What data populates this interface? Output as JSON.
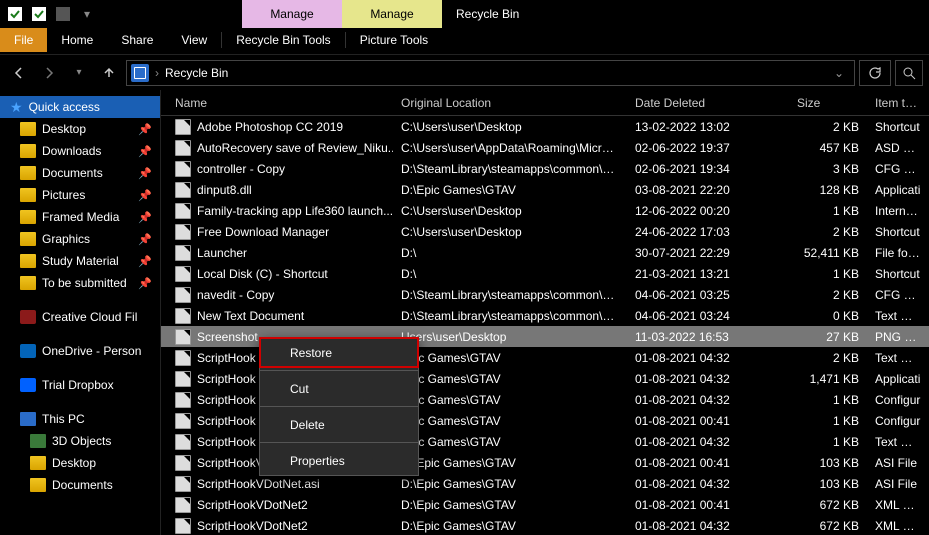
{
  "title": "Recycle Bin",
  "manage_tabs": [
    "Manage",
    "Manage"
  ],
  "ribbon": {
    "file": "File",
    "home": "Home",
    "share": "Share",
    "view": "View",
    "rbt": "Recycle Bin Tools",
    "pt": "Picture Tools"
  },
  "address": "Recycle Bin",
  "sidebar": {
    "quick": "Quick access",
    "pinned": [
      {
        "label": "Desktop"
      },
      {
        "label": "Downloads"
      },
      {
        "label": "Documents"
      },
      {
        "label": "Pictures"
      },
      {
        "label": "Framed Media"
      },
      {
        "label": "Graphics"
      },
      {
        "label": "Study Material"
      },
      {
        "label": "To be submitted"
      }
    ],
    "cc": "Creative Cloud Fil",
    "od": "OneDrive - Person",
    "db": "Trial Dropbox",
    "pc": "This PC",
    "pc_items": [
      {
        "label": "3D Objects"
      },
      {
        "label": "Desktop"
      },
      {
        "label": "Documents"
      }
    ]
  },
  "columns": {
    "name": "Name",
    "loc": "Original Location",
    "date": "Date Deleted",
    "size": "Size",
    "type": "Item type"
  },
  "rows": [
    {
      "name": "Adobe Photoshop CC 2019",
      "loc": "C:\\Users\\user\\Desktop",
      "date": "13-02-2022 13:02",
      "size": "2 KB",
      "type": "Shortcut"
    },
    {
      "name": "AutoRecovery save of Review_Niku...",
      "loc": "C:\\Users\\user\\AppData\\Roaming\\Micros...",
      "date": "02-06-2022 19:37",
      "size": "457 KB",
      "type": "ASD File"
    },
    {
      "name": "controller - Copy",
      "loc": "D:\\SteamLibrary\\steamapps\\common\\C...",
      "date": "02-06-2021 19:34",
      "size": "3 KB",
      "type": "CFG File"
    },
    {
      "name": "dinput8.dll",
      "loc": "D:\\Epic Games\\GTAV",
      "date": "03-08-2021 22:20",
      "size": "128 KB",
      "type": "Applicati"
    },
    {
      "name": "Family-tracking app Life360 launch...",
      "loc": "C:\\Users\\user\\Desktop",
      "date": "12-06-2022 00:20",
      "size": "1 KB",
      "type": "Internet S"
    },
    {
      "name": "Free Download Manager",
      "loc": "C:\\Users\\user\\Desktop",
      "date": "24-06-2022 17:03",
      "size": "2 KB",
      "type": "Shortcut"
    },
    {
      "name": "Launcher",
      "loc": "D:\\",
      "date": "30-07-2021 22:29",
      "size": "52,411 KB",
      "type": "File folde"
    },
    {
      "name": "Local Disk (C) - Shortcut",
      "loc": "D:\\",
      "date": "21-03-2021 13:21",
      "size": "1 KB",
      "type": "Shortcut"
    },
    {
      "name": "navedit - Copy",
      "loc": "D:\\SteamLibrary\\steamapps\\common\\C...",
      "date": "04-06-2021 03:25",
      "size": "2 KB",
      "type": "CFG File"
    },
    {
      "name": "New Text Document",
      "loc": "D:\\SteamLibrary\\steamapps\\common\\C...",
      "date": "04-06-2021 03:24",
      "size": "0 KB",
      "type": "Text Doc"
    },
    {
      "name": "Screenshot",
      "loc": "Users\\user\\Desktop",
      "date": "11-03-2022 16:53",
      "size": "27 KB",
      "type": "PNG File",
      "sel": true
    },
    {
      "name": "ScriptHook",
      "loc": "Epic Games\\GTAV",
      "date": "01-08-2021 04:32",
      "size": "2 KB",
      "type": "Text Doc"
    },
    {
      "name": "ScriptHook",
      "loc": "Epic Games\\GTAV",
      "date": "01-08-2021 04:32",
      "size": "1,471 KB",
      "type": "Applicati"
    },
    {
      "name": "ScriptHook",
      "loc": "Epic Games\\GTAV",
      "date": "01-08-2021 04:32",
      "size": "1 KB",
      "type": "Configur"
    },
    {
      "name": "ScriptHook",
      "loc": "Epic Games\\GTAV",
      "date": "01-08-2021 00:41",
      "size": "1 KB",
      "type": "Configur"
    },
    {
      "name": "ScriptHook",
      "loc": "Epic Games\\GTAV",
      "date": "01-08-2021 04:32",
      "size": "1 KB",
      "type": "Text Doc"
    },
    {
      "name": "ScriptHookVDotNet.asi",
      "loc": "D:\\Epic Games\\GTAV",
      "date": "01-08-2021 00:41",
      "size": "103 KB",
      "type": "ASI File"
    },
    {
      "name": "ScriptHookVDotNet.asi",
      "loc": "D:\\Epic Games\\GTAV",
      "date": "01-08-2021 04:32",
      "size": "103 KB",
      "type": "ASI File"
    },
    {
      "name": "ScriptHookVDotNet2",
      "loc": "D:\\Epic Games\\GTAV",
      "date": "01-08-2021 00:41",
      "size": "672 KB",
      "type": "XML Doc"
    },
    {
      "name": "ScriptHookVDotNet2",
      "loc": "D:\\Epic Games\\GTAV",
      "date": "01-08-2021 04:32",
      "size": "672 KB",
      "type": "XML Doc"
    }
  ],
  "ctx": {
    "restore": "Restore",
    "cut": "Cut",
    "delete": "Delete",
    "props": "Properties"
  }
}
